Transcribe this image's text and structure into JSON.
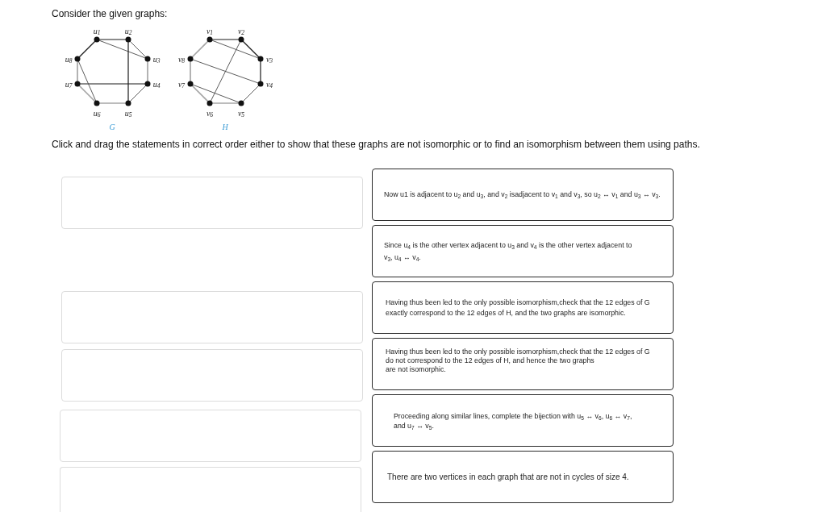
{
  "prompt": "Consider the given graphs:",
  "graphs": [
    {
      "caption": "G",
      "vertices": [
        "u$_{1}$",
        "u$_{2}$",
        "u$_{3}$",
        "u$_{4}$",
        "u$_{5}$",
        "u$_{6}$",
        "u$_{7}$",
        "u$_{8}$"
      ]
    },
    {
      "caption": "H",
      "vertices": [
        "v$_{1}$",
        "v$_{2}$",
        "v$_{3}$",
        "v$_{4}$",
        "v$_{5}$",
        "v$_{6}$",
        "v$_{7}$",
        "v$_{8}$"
      ]
    }
  ],
  "instruction": "Click and drag the statements in correct order either to show that these graphs are not isomorphic or to find an isomorphism between them using paths.",
  "statements": [
    "Now u1 is adjacent to u$_{2}$ and u$_{3}$, and v$_{2}$ isadjacent to v$_{1}$ and v$_{3}$, so u$_{2}$ ↔ v$_{1}$ and u$_{3}$ ↔ v$_{3}$.",
    "Since u$_{4}$ is the other vertex adjacent to u$_{3}$ and v$_{4}$ is the other vertex adjacent to v$_{3}$, u$_{4}$ ↔ v$_{4}$.",
    "Having thus been led to the only possible isomorphism,check that the 12 edges of G exactly correspond to the 12 edges of H, and the two graphs are isomorphic.",
    "Having thus been led to the only possible isomorphism,check that the 12 edges of G\ndo not correspond to the 12 edges of H, and hence the two graphs\nare not isomorphic.",
    "Proceeding along similar lines, complete the bijection with u$_{5}$ ↔ v$_{6}$, u$_{6}$ ↔ v$_{7}$, and u$_{7}$ ↔ v$_{5}$.",
    "There are two vertices in each graph that are not in cycles of size 4."
  ]
}
